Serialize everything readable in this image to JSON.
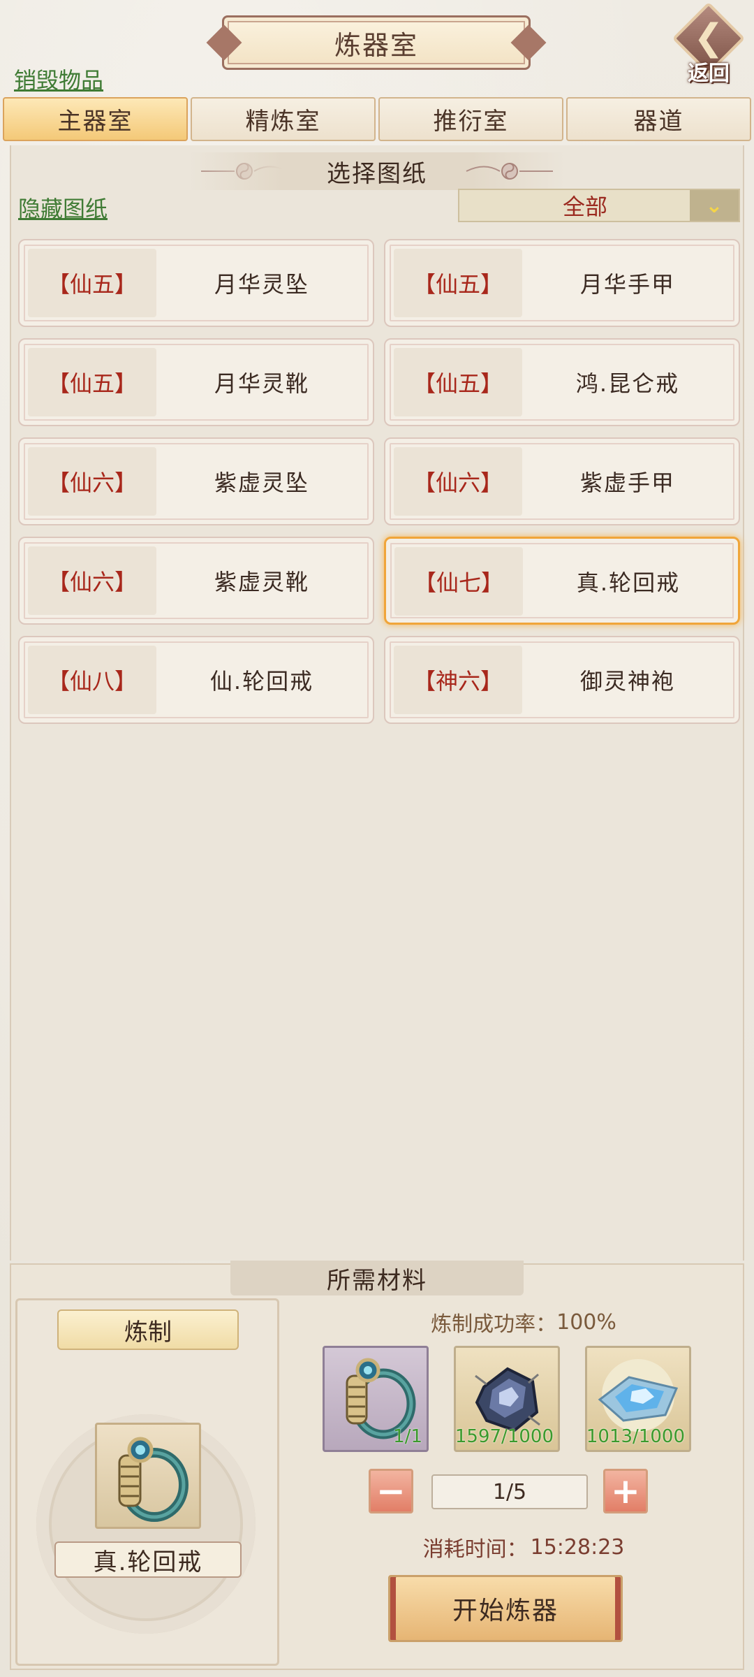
{
  "header": {
    "title": "炼器室",
    "back_label": "返回",
    "destroy_link": "销毁物品"
  },
  "tabs": [
    {
      "label": "主器室",
      "active": true
    },
    {
      "label": "精炼室",
      "active": false
    },
    {
      "label": "推衍室",
      "active": false
    },
    {
      "label": "器道",
      "active": false
    }
  ],
  "blueprints": {
    "section_title": "选择图纸",
    "hide_link": "隐藏图纸",
    "filter_value": "全部",
    "items": [
      {
        "grade": "【仙五】",
        "name": "月华灵坠",
        "selected": false
      },
      {
        "grade": "【仙五】",
        "name": "月华手甲",
        "selected": false
      },
      {
        "grade": "【仙五】",
        "name": "月华灵靴",
        "selected": false
      },
      {
        "grade": "【仙五】",
        "name": "鸿.昆仑戒",
        "selected": false
      },
      {
        "grade": "【仙六】",
        "name": "紫虚灵坠",
        "selected": false
      },
      {
        "grade": "【仙六】",
        "name": "紫虚手甲",
        "selected": false
      },
      {
        "grade": "【仙六】",
        "name": "紫虚灵靴",
        "selected": false
      },
      {
        "grade": "【仙七】",
        "name": "真.轮回戒",
        "selected": true
      },
      {
        "grade": "【仙八】",
        "name": "仙.轮回戒",
        "selected": false
      },
      {
        "grade": "【神六】",
        "name": "御灵神袍",
        "selected": false
      }
    ]
  },
  "materials": {
    "section_title": "所需材料",
    "craft_label": "炼制",
    "product_name": "真.轮回戒",
    "rate_label": "炼制成功率：",
    "rate_value": "100%",
    "items": [
      {
        "icon": "ring-icon",
        "count": "1/1"
      },
      {
        "icon": "ore-icon",
        "count": "1597/1000"
      },
      {
        "icon": "crystal-icon",
        "count": "1013/1000"
      }
    ],
    "quantity": "1/5",
    "time_label": "消耗时间：",
    "time_value": "15:28:23",
    "start_label": "开始炼器"
  },
  "colors": {
    "grade_text": "#a8271b",
    "selected_border": "#f0a53a",
    "active_tab": "#f4c978",
    "link_green": "#3f7b34",
    "count_green": "#3a9a2c"
  }
}
